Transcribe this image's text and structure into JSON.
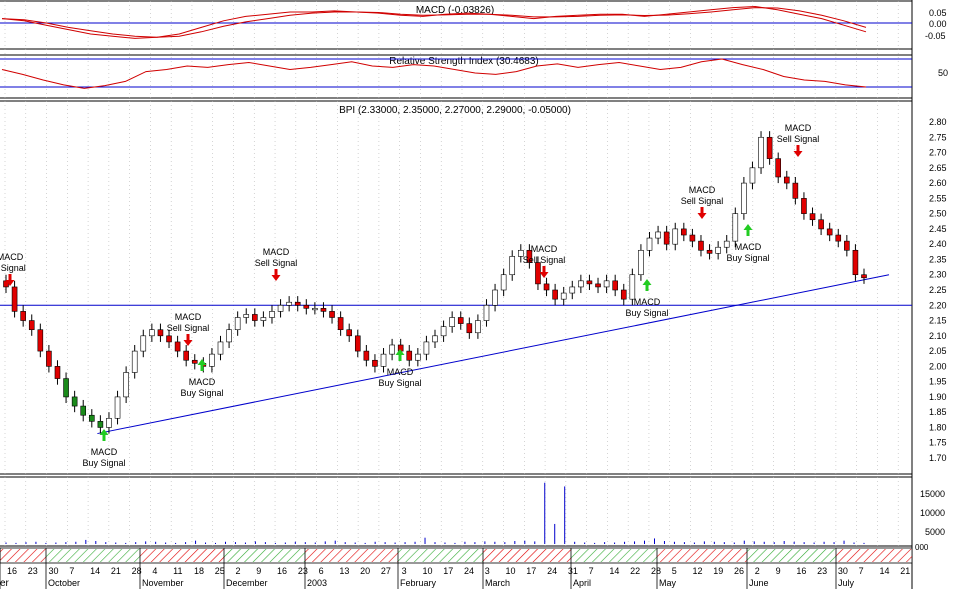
{
  "colors": {
    "panel_line": "#000000",
    "grid": "#b8b8b8",
    "ref_line": "#0000cc",
    "macd_line": "#d00000",
    "up_candle": "#ffffff",
    "down_candle": "#e00000",
    "green_candle": "#1a8a1a",
    "sell_arrow": "#e00000",
    "buy_arrow": "#22cc22",
    "volume": "#0000cc",
    "timebar_red": "#e00000",
    "timebar_green": "#33aa33"
  },
  "chart_data": [
    {
      "panel": "macd",
      "type": "line",
      "title": "MACD (-0.03826)",
      "y_ticks": [
        "0.05",
        "0.00",
        "-0.05"
      ],
      "ylim": [
        -0.09,
        0.09
      ],
      "zero_line": 0,
      "series": [
        {
          "role": "macd",
          "values": [
            0.02,
            0.01,
            -0.01,
            -0.03,
            -0.05,
            -0.06,
            -0.07,
            -0.065,
            -0.05,
            -0.02,
            0.01,
            0.03,
            0.04,
            0.05,
            0.05,
            0.055,
            0.05,
            0.045,
            0.035,
            0.03,
            0.04,
            0.045,
            0.04,
            0.03,
            0.02,
            0.03,
            0.035,
            0.04,
            0.04,
            0.03,
            0.04,
            0.05,
            0.06,
            0.07,
            0.075,
            0.06,
            0.04,
            0.02,
            -0.01,
            -0.04
          ]
        },
        {
          "role": "signal",
          "values": [
            0.02,
            0.015,
            0.0,
            -0.02,
            -0.035,
            -0.05,
            -0.06,
            -0.065,
            -0.06,
            -0.04,
            -0.015,
            0.005,
            0.02,
            0.035,
            0.045,
            0.05,
            0.05,
            0.048,
            0.04,
            0.035,
            0.037,
            0.04,
            0.04,
            0.035,
            0.028,
            0.028,
            0.03,
            0.035,
            0.037,
            0.034,
            0.036,
            0.042,
            0.05,
            0.06,
            0.07,
            0.068,
            0.055,
            0.035,
            0.01,
            -0.02
          ]
        }
      ]
    },
    {
      "panel": "rsi",
      "type": "line",
      "title": "Relative Strength Index (30.4683)",
      "y_ticks": [
        "50"
      ],
      "ylim": [
        20,
        80
      ],
      "ref_lines": [
        30,
        70
      ],
      "series": [
        {
          "role": "rsi",
          "values": [
            55,
            48,
            40,
            33,
            28,
            32,
            38,
            52,
            55,
            60,
            58,
            62,
            65,
            60,
            55,
            58,
            62,
            66,
            60,
            58,
            62,
            60,
            55,
            50,
            48,
            52,
            60,
            63,
            58,
            62,
            65,
            60,
            55,
            58,
            66,
            70,
            62,
            55,
            45,
            40,
            38,
            33,
            30
          ]
        }
      ]
    },
    {
      "panel": "price",
      "type": "candlestick",
      "title": "BPI (2.33000, 2.35000, 2.27000, 2.29000, -0.05000)",
      "y_ticks": [
        "2.80",
        "2.75",
        "2.70",
        "2.65",
        "2.60",
        "2.55",
        "2.50",
        "2.45",
        "2.40",
        "2.35",
        "2.30",
        "2.25",
        "2.20",
        "2.15",
        "2.10",
        "2.05",
        "2.00",
        "1.95",
        "1.90",
        "1.85",
        "1.80",
        "1.75",
        "1.70"
      ],
      "ylim": [
        1.67,
        2.83
      ],
      "horizontal_line": 2.2,
      "trendline": {
        "from": [
          "21 Oct",
          1.78
        ],
        "to": [
          "14 Jul",
          2.3
        ]
      },
      "closes": [
        2.26,
        2.18,
        2.15,
        2.12,
        2.05,
        2.0,
        1.96,
        1.9,
        1.87,
        1.84,
        1.82,
        1.8,
        1.83,
        1.9,
        1.98,
        2.05,
        2.1,
        2.12,
        2.1,
        2.08,
        2.05,
        2.02,
        2.01,
        2.0,
        2.04,
        2.08,
        2.12,
        2.16,
        2.17,
        2.15,
        2.16,
        2.18,
        2.2,
        2.21,
        2.2,
        2.19,
        2.19,
        2.18,
        2.16,
        2.12,
        2.1,
        2.05,
        2.02,
        2.0,
        2.04,
        2.07,
        2.05,
        2.02,
        2.04,
        2.08,
        2.1,
        2.13,
        2.16,
        2.14,
        2.11,
        2.15,
        2.2,
        2.25,
        2.3,
        2.36,
        2.38,
        2.34,
        2.27,
        2.25,
        2.22,
        2.24,
        2.26,
        2.28,
        2.27,
        2.26,
        2.28,
        2.25,
        2.22,
        2.3,
        2.38,
        2.42,
        2.44,
        2.4,
        2.45,
        2.43,
        2.41,
        2.38,
        2.37,
        2.39,
        2.41,
        2.5,
        2.6,
        2.65,
        2.75,
        2.68,
        2.62,
        2.6,
        2.55,
        2.5,
        2.48,
        2.45,
        2.43,
        2.41,
        2.38,
        2.3,
        2.29
      ],
      "annotations": [
        {
          "kind": "sell",
          "lines": [
            "MACD",
            "ll Signal"
          ]
        },
        {
          "kind": "buy",
          "lines": [
            "MACD",
            "Buy Signal"
          ]
        },
        {
          "kind": "sell",
          "lines": [
            "MACD",
            "Sell Signal"
          ]
        },
        {
          "kind": "buy",
          "lines": [
            "MACD",
            "Buy Signal"
          ]
        },
        {
          "kind": "sell",
          "lines": [
            "MACD",
            "Sell Signal"
          ]
        },
        {
          "kind": "buy",
          "lines": [
            "MACD",
            "Buy Signal"
          ]
        },
        {
          "kind": "sell",
          "lines": [
            "MACD",
            "Sell Signal"
          ]
        },
        {
          "kind": "buy",
          "lines": [
            "MACD",
            "Buy Signal"
          ]
        },
        {
          "kind": "sell",
          "lines": [
            "MACD",
            "Sell Signal"
          ]
        },
        {
          "kind": "buy",
          "lines": [
            "MACD",
            "Buy Signal"
          ]
        },
        {
          "kind": "sell",
          "lines": [
            "MACD",
            "Sell Signal"
          ]
        }
      ]
    },
    {
      "panel": "volume",
      "type": "bar",
      "y_ticks": [
        "15000",
        "10000",
        "5000"
      ],
      "ylim": [
        0,
        17500
      ],
      "values": [
        400,
        300,
        500,
        600,
        300,
        400,
        500,
        600,
        1100,
        800,
        500,
        400,
        300,
        500,
        700,
        600,
        400,
        300,
        500,
        900,
        400,
        300,
        600,
        500,
        400,
        700,
        500,
        300,
        400,
        600,
        500,
        400,
        700,
        900,
        500,
        400,
        300,
        600,
        500,
        400,
        500,
        600,
        1700,
        500,
        400,
        300,
        600,
        500,
        700,
        600,
        500,
        800,
        900,
        700,
        16500,
        5400,
        15500,
        600,
        400,
        300,
        500,
        400,
        600,
        700,
        900,
        1500,
        800,
        600,
        500,
        400,
        700,
        600,
        500,
        400,
        900,
        700,
        600,
        500,
        800,
        600,
        500,
        400,
        600,
        500,
        900,
        400,
        300
      ]
    }
  ],
  "x_axis": {
    "day_ticks": [
      "16",
      "23",
      "30",
      "7",
      "14",
      "21",
      "28",
      "4",
      "11",
      "18",
      "25",
      "2",
      "9",
      "16",
      "23",
      "6",
      "13",
      "20",
      "27",
      "3",
      "10",
      "17",
      "24",
      "3",
      "10",
      "17",
      "24",
      "31",
      "7",
      "14",
      "22",
      "28",
      "5",
      "12",
      "19",
      "26",
      "2",
      "9",
      "16",
      "23",
      "30",
      "7",
      "14",
      "21"
    ],
    "month_labels": [
      "October",
      "November",
      "December",
      "2003",
      "February",
      "March",
      "April",
      "May",
      "June",
      "July"
    ],
    "left_edge_label": "er",
    "corner_label": "000"
  }
}
